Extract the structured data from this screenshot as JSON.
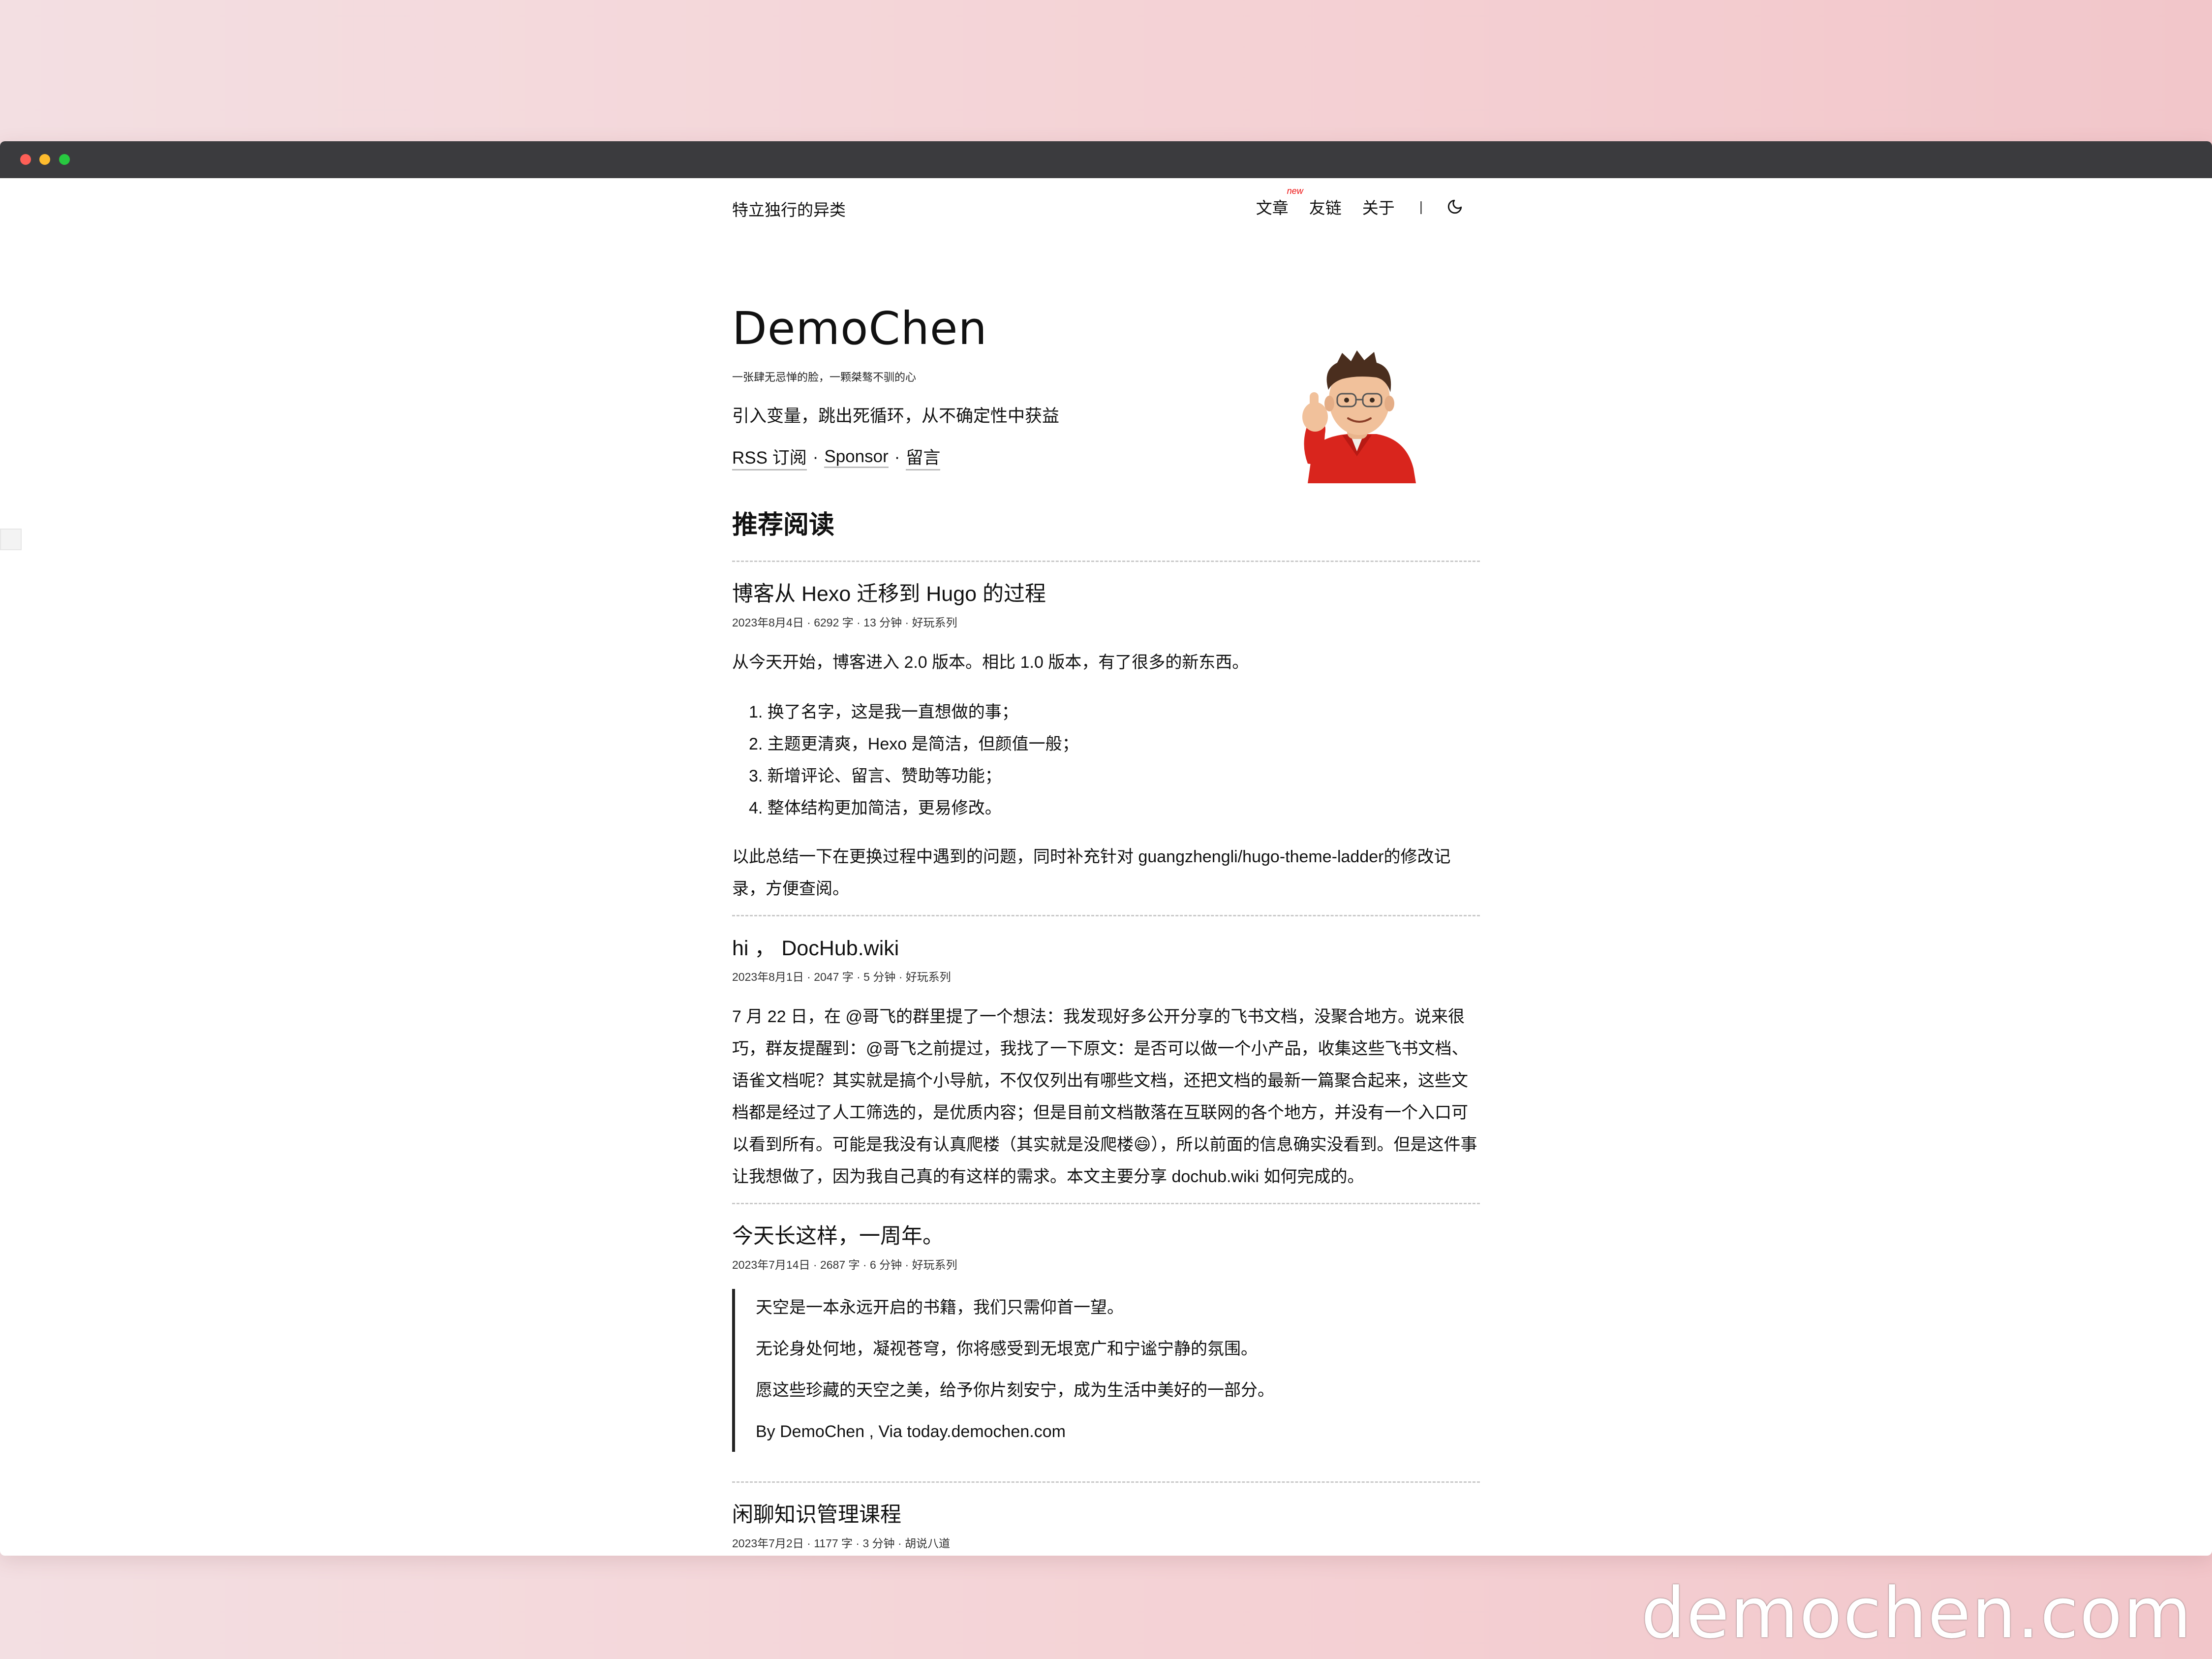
{
  "nav": {
    "site_title": "特立独行的异类",
    "links": [
      "文章",
      "友链",
      "关于"
    ],
    "new_badge": "new",
    "separator": "|",
    "theme_toggle_icon": "moon-icon"
  },
  "hero": {
    "name": "DemoChen",
    "subtitle": "一张肆无忌惮的脸，一颗桀骜不驯的心",
    "motto": "引入变量，跳出死循环，从不确定性中获益",
    "links": [
      "RSS 订阅",
      "Sponsor",
      "留言"
    ],
    "link_separator": "·",
    "avatar_icon": "memoji-avatar"
  },
  "recommended": {
    "title": "推荐阅读",
    "posts": [
      {
        "title": "博客从 Hexo 迁移到 Hugo 的过程",
        "meta": "2023年8月4日 · 6292 字 · 13 分钟 · 好玩系列",
        "intro": "从今天开始，博客进入 2.0 版本。相比 1.0 版本，有了很多的新东西。",
        "list": [
          "1. 换了名字，这是我一直想做的事；",
          "2. 主题更清爽，Hexo 是简洁，但颜值一般；",
          "3. 新增评论、留言、赞助等功能；",
          "4. 整体结构更加简洁，更易修改。"
        ],
        "outro": "以此总结一下在更换过程中遇到的问题，同时补充针对 guangzhengli/hugo-theme-ladder的修改记录，方便查阅。"
      },
      {
        "title": "hi ， DocHub.wiki",
        "meta": "2023年8月1日 · 2047 字 · 5 分钟 · 好玩系列",
        "body": "7 月 22 日，在 @哥飞的群里提了一个想法：我发现好多公开分享的飞书文档，没聚合地方。说来很巧，群友提醒到：@哥飞之前提过，我找了一下原文：是否可以做一个小产品，收集这些飞书文档、语雀文档呢？其实就是搞个小导航，不仅仅列出有哪些文档，还把文档的最新一篇聚合起来，这些文档都是经过了人工筛选的，是优质内容；但是目前文档散落在互联网的各个地方，并没有一个入口可以看到所有。可能是我没有认真爬楼（其实就是没爬楼😄），所以前面的信息确实没看到。但是这件事让我想做了，因为我自己真的有这样的需求。本文主要分享 dochub.wiki 如何完成的。"
      },
      {
        "title": "今天长这样，一周年。",
        "meta": "2023年7月14日 · 2687 字 · 6 分钟 · 好玩系列",
        "quote": [
          "天空是一本永远开启的书籍，我们只需仰首一望。",
          "无论身处何地，凝视苍穹，你将感受到无垠宽广和宁谧宁静的氛围。",
          "愿这些珍藏的天空之美，给予你片刻安宁，成为生活中美好的一部分。",
          "By DemoChen , Via today.demochen.com"
        ]
      },
      {
        "title": "闲聊知识管理课程",
        "meta": "2023年7月2日 · 1177 字 · 3 分钟 · 胡说八道"
      }
    ]
  },
  "watermark": "demochen.com",
  "colors": {
    "titlebar": "#3b3b3e",
    "traffic_red": "#fe5f57",
    "traffic_yellow": "#febc2e",
    "traffic_green": "#28c840",
    "new_badge": "#e11111",
    "background_gradient_left": "#f3dfe2",
    "background_gradient_right": "#f2c6ca"
  }
}
